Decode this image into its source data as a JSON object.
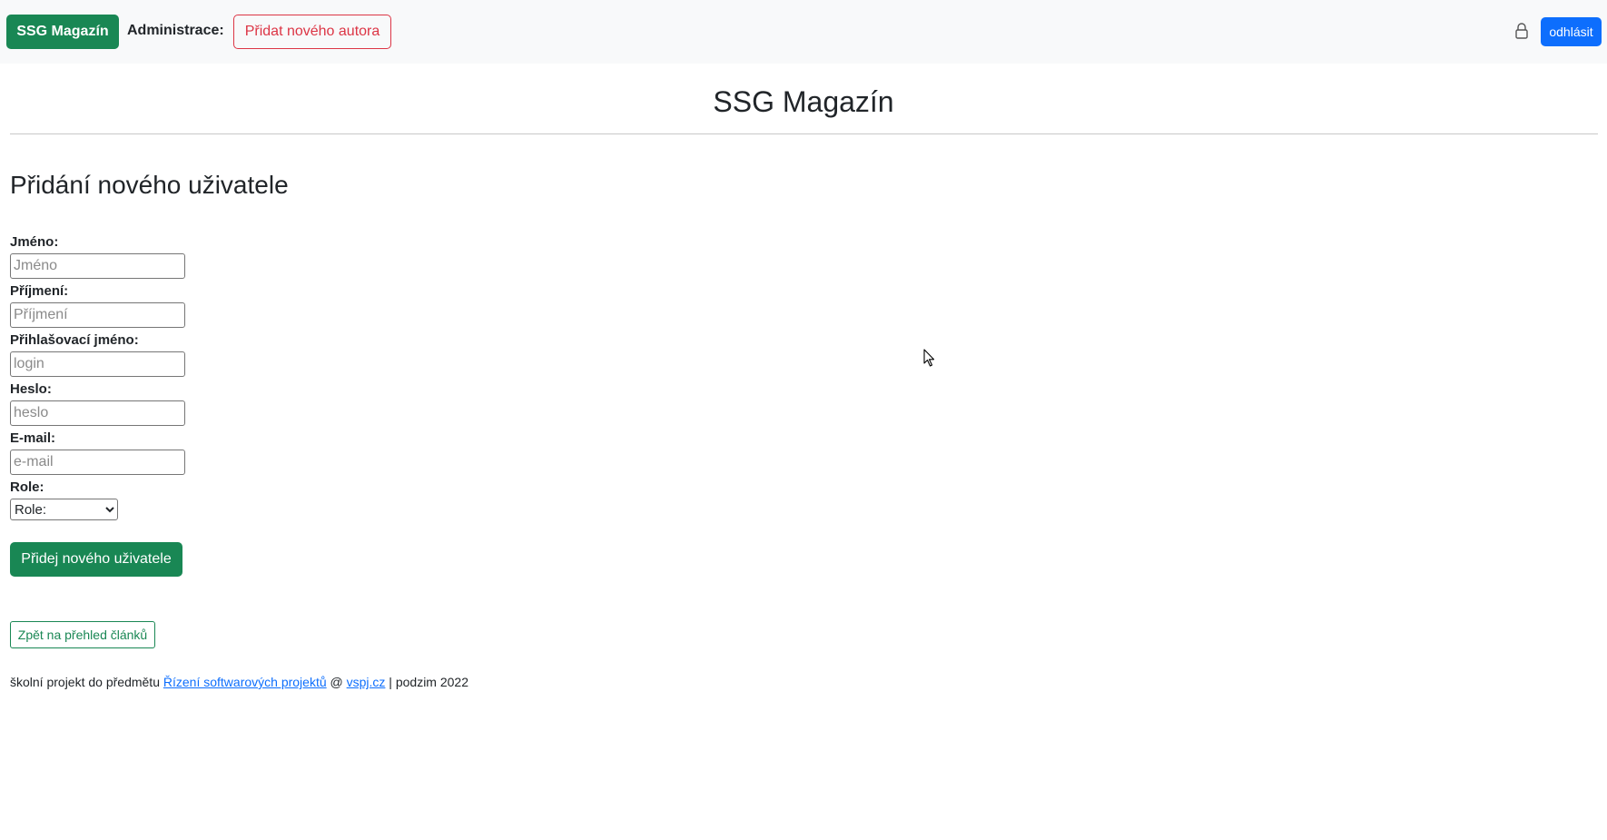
{
  "navbar": {
    "brand_label": "SSG Magazín",
    "admin_label": "Administrace:",
    "add_author_label": "Přidat nového autora",
    "lock_icon": "lock-icon",
    "logout_label": "odhlásit"
  },
  "site_title": "SSG Magazín",
  "page_heading": "Přidání nového uživatele",
  "form": {
    "first_name": {
      "label": "Jméno:",
      "placeholder": "Jméno",
      "value": ""
    },
    "last_name": {
      "label": "Příjmení:",
      "placeholder": "Příjmení",
      "value": ""
    },
    "login": {
      "label": "Přihlašovací jméno:",
      "placeholder": "login",
      "value": ""
    },
    "password": {
      "label": "Heslo:",
      "placeholder": "heslo",
      "value": ""
    },
    "email": {
      "label": "E-mail:",
      "placeholder": "e-mail",
      "value": ""
    },
    "role": {
      "label": "Role:",
      "selected": "Role:"
    },
    "submit_label": "Přidej nového uživatele"
  },
  "back_label": "Zpět na přehled článků",
  "footer": {
    "prefix": "školní projekt do předmětu ",
    "course_link": "Řízení softwarových projektů",
    "at": " @ ",
    "site_link": "vspj.cz",
    "suffix": " | podzim 2022"
  },
  "colors": {
    "success": "#198754",
    "danger": "#dc3545",
    "primary": "#0d6efd",
    "navbar_bg": "#f8f9fa"
  }
}
